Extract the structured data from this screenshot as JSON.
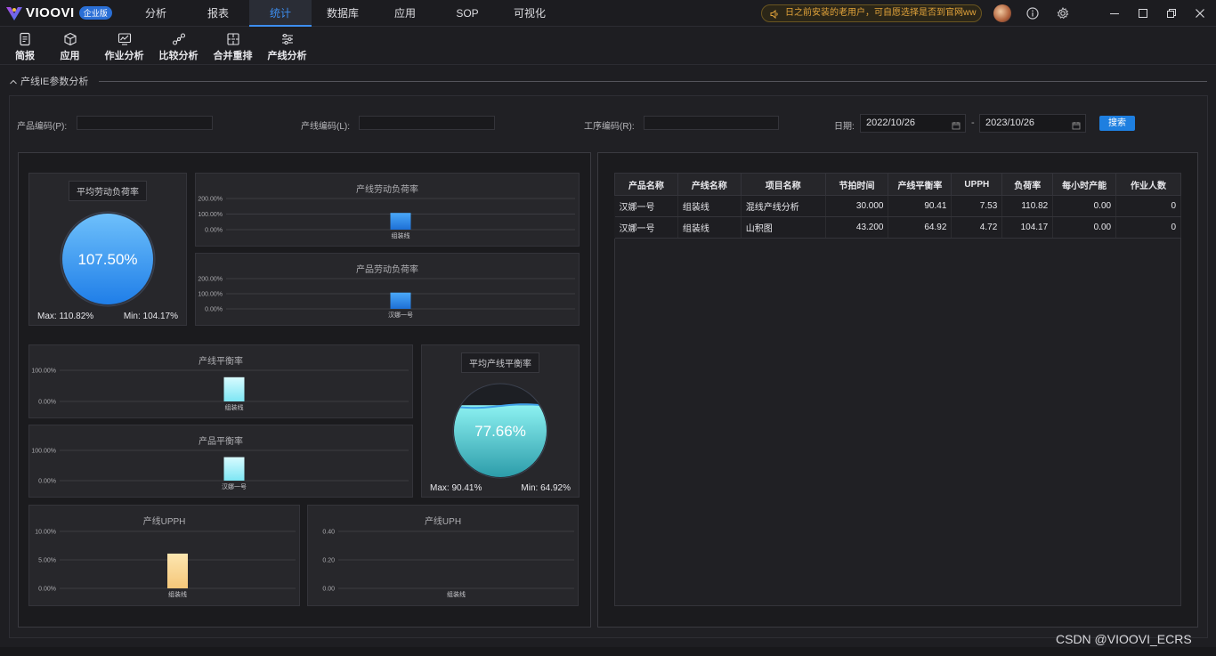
{
  "app": {
    "logo_text": "VIOOVI",
    "edition_badge": "企业版",
    "notice": "日之前安装的老用户，可自愿选择是否到官网ww"
  },
  "nav": {
    "tabs": [
      {
        "label": "分析"
      },
      {
        "label": "报表"
      },
      {
        "label": "统计",
        "active": true
      },
      {
        "label": "数据库"
      },
      {
        "label": "应用"
      },
      {
        "label": "SOP"
      },
      {
        "label": "可视化"
      }
    ]
  },
  "toolbar": {
    "items": [
      {
        "label": "简报",
        "icon": "document-icon"
      },
      {
        "label": "应用",
        "icon": "cube-icon"
      },
      {
        "label": "作业分析",
        "icon": "monitor-chart-icon"
      },
      {
        "label": "比较分析",
        "icon": "nodes-icon"
      },
      {
        "label": "合并重排",
        "icon": "grid-merge-icon"
      },
      {
        "label": "产线分析",
        "icon": "sliders-icon"
      }
    ]
  },
  "section": {
    "title": "产线IE参数分析"
  },
  "filters": {
    "product_code_label": "产品编码(P):",
    "line_code_label": "产线编码(L):",
    "process_code_label": "工序编码(R):",
    "date_label": "日期:",
    "date_from": "2022/10/26",
    "date_sep": "-",
    "date_to": "2023/10/26",
    "search_label": "搜索"
  },
  "gauges": {
    "load": {
      "title": "平均劳动负荷率",
      "value": "107.50%",
      "fill_fraction": 1.0,
      "max_text": "Max: 110.82%",
      "min_text": "Min: 104.17%"
    },
    "balance": {
      "title": "平均产线平衡率",
      "value": "77.66%",
      "fill_fraction": 0.7766,
      "max_text": "Max: 90.41%",
      "min_text": "Min: 64.92%"
    }
  },
  "chart_data": [
    {
      "id": "line-load",
      "type": "bar",
      "title": "产线劳动负荷率",
      "categories": [
        "组装线"
      ],
      "values": [
        107.5
      ],
      "yticks": [
        "200.00%",
        "100.00%",
        "0.00%"
      ],
      "ylim": [
        0,
        200
      ],
      "color_top": "#4aa8f8",
      "color_bottom": "#1d6fd6"
    },
    {
      "id": "product-load",
      "type": "bar",
      "title": "产品劳动负荷率",
      "categories": [
        "汉娜一号"
      ],
      "values": [
        107.5
      ],
      "yticks": [
        "200.00%",
        "100.00%",
        "0.00%"
      ],
      "ylim": [
        0,
        200
      ],
      "color_top": "#4aa8f8",
      "color_bottom": "#1d6fd6"
    },
    {
      "id": "line-balance",
      "type": "bar",
      "title": "产线平衡率",
      "categories": [
        "组装线"
      ],
      "values": [
        77.66
      ],
      "yticks": [
        "100.00%",
        "0.00%"
      ],
      "ylim": [
        0,
        100
      ],
      "color_top": "#d8fbff",
      "color_bottom": "#7de6f4"
    },
    {
      "id": "product-balance",
      "type": "bar",
      "title": "产品平衡率",
      "categories": [
        "汉娜一号"
      ],
      "values": [
        77.66
      ],
      "yticks": [
        "100.00%",
        "0.00%"
      ],
      "ylim": [
        0,
        100
      ],
      "color_top": "#d8fbff",
      "color_bottom": "#7de6f4"
    },
    {
      "id": "line-upph",
      "type": "bar",
      "title": "产线UPPH",
      "categories": [
        "组装线"
      ],
      "values": [
        6.1
      ],
      "yticks": [
        "10.00%",
        "5.00%",
        "0.00%"
      ],
      "ylim": [
        0,
        10
      ],
      "color_top": "#fde6b0",
      "color_bottom": "#f5c77a"
    },
    {
      "id": "line-uph",
      "type": "bar",
      "title": "产线UPH",
      "categories": [
        "组装线"
      ],
      "values": [
        0
      ],
      "yticks": [
        "0.40",
        "0.20",
        "0.00"
      ],
      "ylim": [
        0,
        0.4
      ],
      "color_top": "#fde6b0",
      "color_bottom": "#f5c77a"
    }
  ],
  "table": {
    "headers": [
      "产品名称",
      "产线名称",
      "项目名称",
      "节拍时间",
      "产线平衡率",
      "UPPH",
      "负荷率",
      "每小时产能",
      "作业人数"
    ],
    "rows": [
      [
        "汉娜一号",
        "组装线",
        "混线产线分析",
        "30.000",
        "90.41",
        "7.53",
        "110.82",
        "0.00",
        "0"
      ],
      [
        "汉娜一号",
        "组装线",
        "山积图",
        "43.200",
        "64.92",
        "4.72",
        "104.17",
        "0.00",
        "0"
      ]
    ]
  },
  "watermark": "CSDN @VIOOVI_ECRS",
  "colors": {
    "accent": "#3d8ef0",
    "search_button": "#1e7fe0",
    "notice_text": "#e2a33a"
  }
}
